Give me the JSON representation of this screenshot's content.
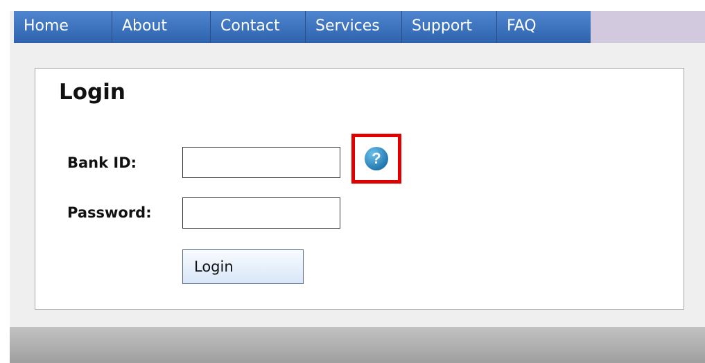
{
  "nav": {
    "items": [
      {
        "label": "Home"
      },
      {
        "label": "About"
      },
      {
        "label": "Contact"
      },
      {
        "label": "Services"
      },
      {
        "label": "Support"
      },
      {
        "label": "FAQ"
      }
    ]
  },
  "login": {
    "title": "Login",
    "bank_id_label": "Bank ID:",
    "bank_id_value": "",
    "password_label": "Password:",
    "password_value": "",
    "button_label": "Login"
  },
  "help": {
    "icon": "question-mark-icon",
    "glyph": "?",
    "highlight_color": "#e00000"
  },
  "colors": {
    "nav_blue": "#2e62ad",
    "nav_filler": "#d2c9df",
    "panel_background": "#ffffff",
    "page_background": "#efefef"
  }
}
